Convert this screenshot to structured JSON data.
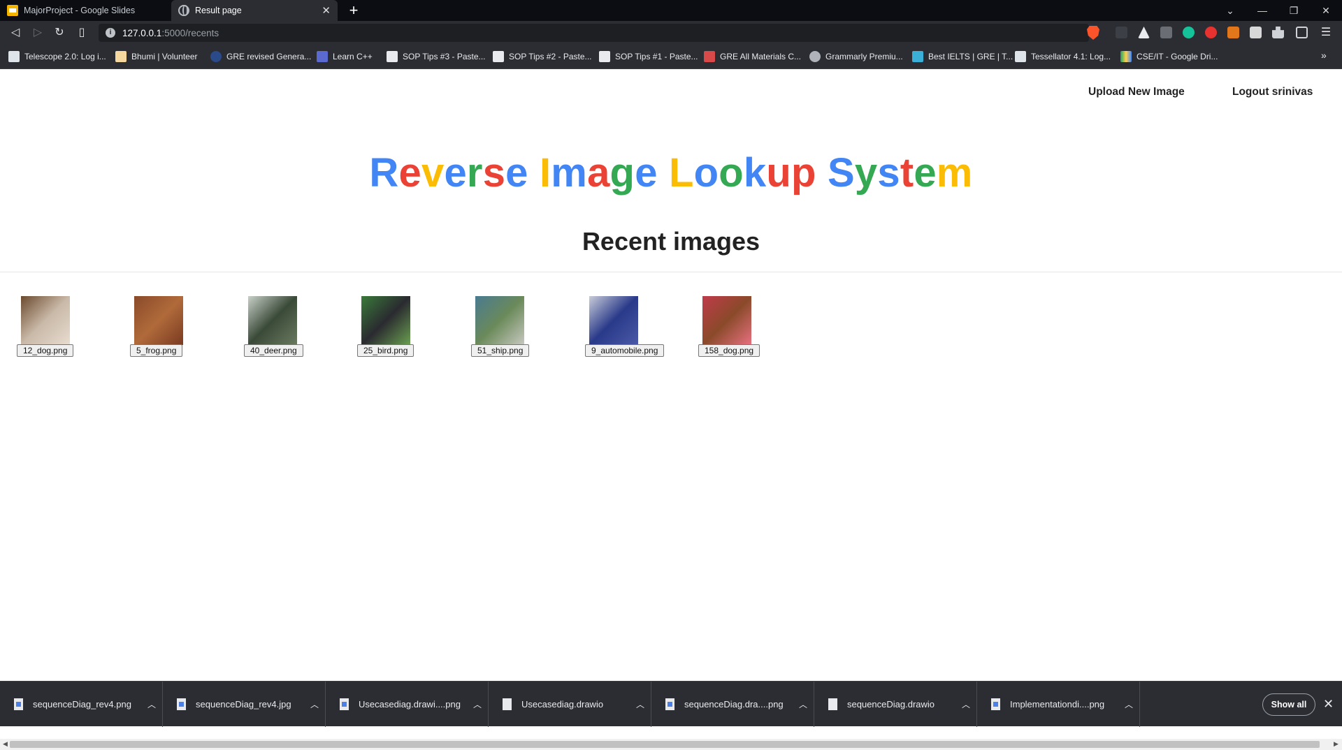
{
  "tabs": [
    {
      "title": "MajorProject - Google Slides",
      "icon": "google-slides-icon"
    },
    {
      "title": "Result page",
      "icon": "globe-icon",
      "active": true
    }
  ],
  "window_controls": {
    "tab_search": "⌄",
    "minimize": "—",
    "restore": "❐",
    "close": "✕"
  },
  "address_bar": {
    "host": "127.0.0.1",
    "path": ":5000/recents"
  },
  "bookmarks": [
    "Telescope 2.0: Log i...",
    "Bhumi | Volunteer",
    "GRE revised Genera...",
    "Learn C++",
    "SOP Tips #3 - Paste...",
    "SOP Tips #2 - Paste...",
    "SOP Tips #1 - Paste...",
    "GRE All Materials C...",
    "Grammarly Premiu...",
    "Best IELTS | GRE | T...",
    "Tessellator 4.1: Log...",
    "CSE/IT - Google Dri..."
  ],
  "bookmarks_more": "»",
  "nav": {
    "upload": "Upload New Image",
    "logout": "Logout srinivas"
  },
  "title_letters": [
    {
      "ch": "R",
      "color": "#4285f4"
    },
    {
      "ch": "e",
      "color": "#ea4335"
    },
    {
      "ch": "v",
      "color": "#fbbc05"
    },
    {
      "ch": "e",
      "color": "#4285f4"
    },
    {
      "ch": "r",
      "color": "#34a853"
    },
    {
      "ch": "s",
      "color": "#ea4335"
    },
    {
      "ch": "e",
      "color": "#4285f4"
    },
    {
      "ch": " ",
      "color": "#000"
    },
    {
      "ch": "I",
      "color": "#fbbc05"
    },
    {
      "ch": "m",
      "color": "#4285f4"
    },
    {
      "ch": "a",
      "color": "#ea4335"
    },
    {
      "ch": "g",
      "color": "#34a853"
    },
    {
      "ch": "e",
      "color": "#4285f4"
    },
    {
      "ch": " ",
      "color": "#000"
    },
    {
      "ch": "L",
      "color": "#fbbc05"
    },
    {
      "ch": "o",
      "color": "#4285f4"
    },
    {
      "ch": "o",
      "color": "#34a853"
    },
    {
      "ch": "k",
      "color": "#4285f4"
    },
    {
      "ch": "u",
      "color": "#ea4335"
    },
    {
      "ch": "p",
      "color": "#ea4335"
    },
    {
      "ch": " ",
      "color": "#000"
    },
    {
      "ch": "S",
      "color": "#4285f4"
    },
    {
      "ch": "y",
      "color": "#34a853"
    },
    {
      "ch": "s",
      "color": "#4285f4"
    },
    {
      "ch": "t",
      "color": "#ea4335"
    },
    {
      "ch": "e",
      "color": "#34a853"
    },
    {
      "ch": "m",
      "color": "#fbbc05"
    }
  ],
  "section_title": "Recent images",
  "recent_images": [
    {
      "name": "12_dog.png",
      "colors": [
        "#6b4a2e",
        "#c9b9a8",
        "#e8ddd0"
      ]
    },
    {
      "name": "5_frog.png",
      "colors": [
        "#8a4a2a",
        "#b06a3a",
        "#7a3a22"
      ]
    },
    {
      "name": "40_deer.png",
      "colors": [
        "#c8d0c8",
        "#3a4a38",
        "#6a7a60"
      ]
    },
    {
      "name": "25_bird.png",
      "colors": [
        "#3a7a3a",
        "#2a2a30",
        "#6aa050"
      ]
    },
    {
      "name": "51_ship.png",
      "colors": [
        "#4a7a90",
        "#6a8a5a",
        "#c8c8c0"
      ]
    },
    {
      "name": "9_automobile.png",
      "colors": [
        "#c8ccd8",
        "#2a3a8a",
        "#4a5aa8"
      ]
    },
    {
      "name": "158_dog.png",
      "colors": [
        "#c03a4a",
        "#8a4a2a",
        "#e87080"
      ]
    }
  ],
  "downloads": [
    {
      "name": "sequenceDiag_rev4.png",
      "icon": "image-file-icon"
    },
    {
      "name": "sequenceDiag_rev4.jpg",
      "icon": "image-file-icon"
    },
    {
      "name": "Usecasediag.drawi....png",
      "icon": "image-file-icon"
    },
    {
      "name": "Usecasediag.drawio",
      "icon": "document-file-icon"
    },
    {
      "name": "sequenceDiag.dra....png",
      "icon": "image-file-icon"
    },
    {
      "name": "sequenceDiag.drawio",
      "icon": "document-file-icon"
    },
    {
      "name": "Implementationdi....png",
      "icon": "image-file-icon"
    }
  ],
  "show_all": "Show all"
}
